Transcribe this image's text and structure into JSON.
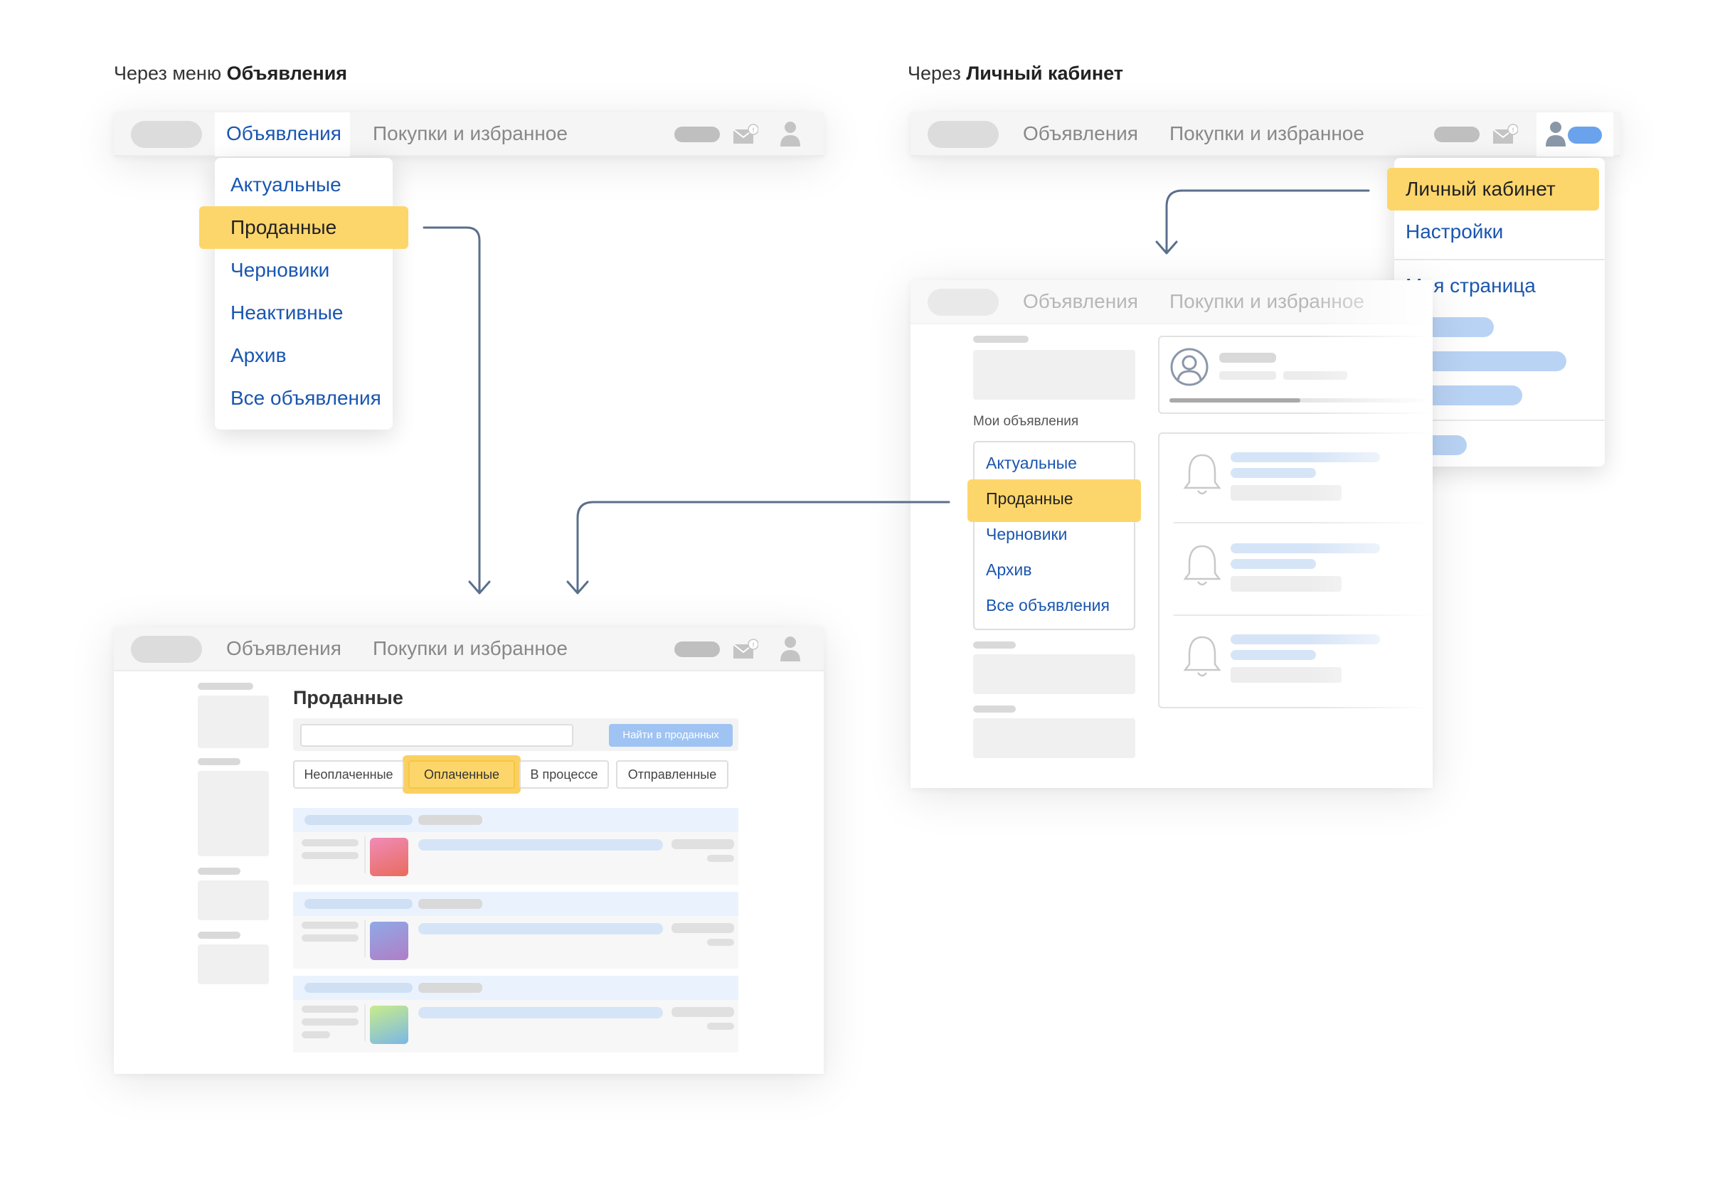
{
  "captions": {
    "left_prefix": "Через меню ",
    "left_bold": "Объявления",
    "right_prefix": "Через ",
    "right_bold": "Личный кабинет"
  },
  "topnav": {
    "ads": "Объявления",
    "purchases": "Покупки и избранное",
    "mail_badge": "!"
  },
  "ads_menu": {
    "items": [
      "Актуальные",
      "Проданные",
      "Черновики",
      "Неактивные",
      "Архив",
      "Все объявления"
    ],
    "selected_index": 1
  },
  "account_menu": {
    "items": [
      "Личный кабинет",
      "Настройки",
      "Моя страница"
    ],
    "selected_index": 0
  },
  "account_page": {
    "section_label": "Мои объявления",
    "items": [
      "Актуальные",
      "Проданные",
      "Черновики",
      "Архив",
      "Все объявления"
    ],
    "selected_index": 1
  },
  "sold_page": {
    "title": "Проданные",
    "search_button": "Найти в проданных",
    "search_placeholder": "",
    "tabs": [
      "Неоплаченные",
      "Оплаченные",
      "В процессе",
      "Отправленные"
    ],
    "selected_tab": 1
  },
  "colors": {
    "highlight": "#fdd66b",
    "link": "#1a56b0",
    "arrow": "#5a6f8c"
  },
  "icons": [
    "mail-icon",
    "user-icon",
    "avatar-icon",
    "bell-icon"
  ]
}
